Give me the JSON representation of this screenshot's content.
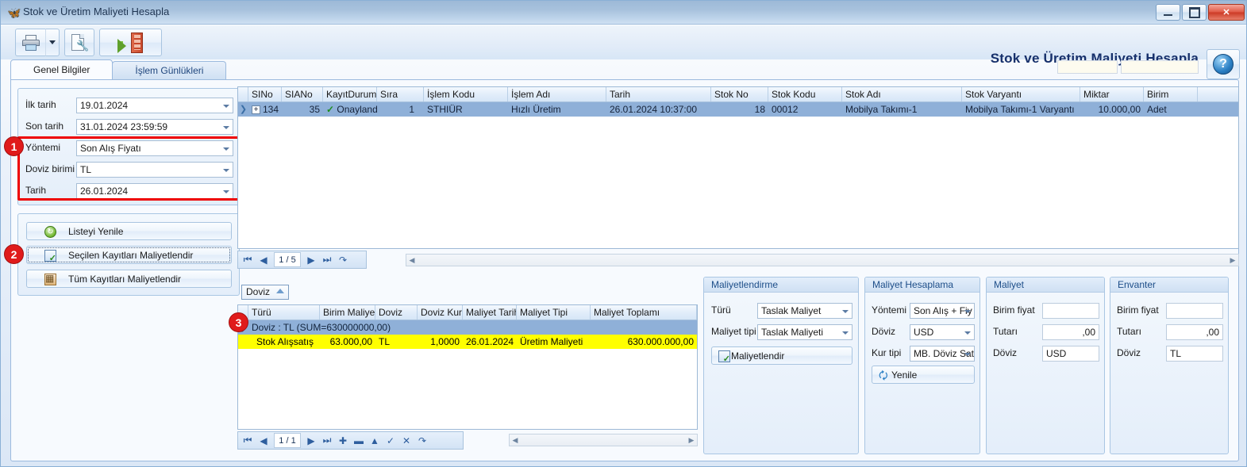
{
  "window": {
    "title": "Stok ve Üretim Maliyeti Hesapla",
    "app_icon": "butterfly-icon",
    "minimize": "–",
    "maximize": "□",
    "close": "✕"
  },
  "toolbar": {
    "print_icon": "printer-icon",
    "print_dropdown_icon": "chevron-down-icon",
    "settings_icon": "document-settings-icon",
    "exit_icon": "exit-door-icon",
    "brand_title": "Stok ve Üretim Maliyeti Hesapla",
    "help_label": "?"
  },
  "tabs": [
    {
      "label": "Genel Bilgiler",
      "active": true
    },
    {
      "label": "İşlem Günlükleri",
      "active": false
    }
  ],
  "filters": {
    "rows": [
      {
        "label": "İlk tarih",
        "value": "19.01.2024"
      },
      {
        "label": "Son tarih",
        "value": "31.01.2024 23:59:59"
      },
      {
        "label": "Yöntemi",
        "value": "Son Alış Fiyatı"
      },
      {
        "label": "Doviz birimi",
        "value": "TL"
      },
      {
        "label": "Tarih",
        "value": "26.01.2024"
      }
    ]
  },
  "actions": {
    "buttons": [
      {
        "label": "Listeyi Yenile",
        "icon": "refresh-icon"
      },
      {
        "label": "Seçilen Kayıtları Maliyetlendir",
        "icon": "selected-records-icon"
      },
      {
        "label": "Tüm Kayıtları Maliyetlendir",
        "icon": "all-records-icon"
      }
    ]
  },
  "callouts": [
    {
      "number": "1"
    },
    {
      "number": "2"
    },
    {
      "number": "3"
    }
  ],
  "top_grid": {
    "columns": [
      "SINo",
      "SIANo",
      "KayıtDurumu",
      "Sıra",
      "İşlem Kodu",
      "İşlem Adı",
      "Tarih",
      "Stok No",
      "Stok Kodu",
      "Stok Adı",
      "Stok Varyantı",
      "Miktar",
      "Birim"
    ],
    "sorted_column": "Sıra",
    "rows": [
      {
        "expander": "+",
        "SINo": "134",
        "SIANo": "35",
        "KayıtDurumu": "Onaylandı",
        "status_icon": "check-icon",
        "Sıra": "1",
        "İşlem Kodu": "STHIÜR",
        "İşlem Adı": "Hızlı Üretim",
        "Tarih": "26.01.2024 10:37:00",
        "Stok No": "18",
        "Stok Kodu": "00012",
        "Stok Adı": "Mobilya Takımı-1",
        "Stok Varyantı": "Mobilya Takımı-1 Varyantı",
        "Miktar": "10.000,00",
        "Birim": "Adet"
      }
    ],
    "nav": {
      "first": "⏮",
      "prev": "◀",
      "position": "1 / 5",
      "next": "▶",
      "last": "⏭",
      "refresh": "↷"
    }
  },
  "bottom_grid": {
    "group_chip": "Doviz",
    "columns": [
      "Türü",
      "Birim Maliyet",
      "Doviz",
      "Doviz Kuru",
      "Maliyet Tarihi",
      "Maliyet Tipi",
      "Maliyet Toplamı"
    ],
    "sorted_column": "Doviz",
    "group_row": "Doviz : TL (SUM=630000000,00)",
    "rows": [
      {
        "Türü": "Stok Alışsatış",
        "Birim Maliyet": "63.000,00",
        "Doviz": "TL",
        "Doviz Kuru": "1,0000",
        "Maliyet Tarihi": "26.01.2024",
        "Maliyet Tipi": "Üretim Maliyeti",
        "Maliyet Toplamı": "630.000.000,00"
      }
    ],
    "nav": {
      "first": "⏮",
      "prev": "◀",
      "position": "1 / 1",
      "next": "▶",
      "last": "⏭",
      "add": "✚",
      "delete": "▬",
      "edit": "▲",
      "post": "✓",
      "cancel": "✕",
      "refresh": "↷"
    }
  },
  "panel_maliyetlendirme": {
    "title": "Maliyetlendirme",
    "fields": [
      {
        "label": "Türü",
        "value": "Taslak Maliyet"
      },
      {
        "label": "Maliyet tipi",
        "value": "Taslak Maliyeti"
      }
    ],
    "button": {
      "label": "Maliyetlendir",
      "icon": "cost-calc-icon"
    }
  },
  "panel_maliyet_hesaplama": {
    "title": "Maliyet Hesaplama",
    "fields": [
      {
        "label": "Yöntemi",
        "value": "Son Alış + Fiy"
      },
      {
        "label": "Döviz",
        "value": "USD"
      },
      {
        "label": "Kur tipi",
        "value": "MB. Döviz Satı"
      }
    ],
    "button": {
      "label": "Yenile",
      "icon": "refresh-blue-icon"
    }
  },
  "panel_maliyet": {
    "title": "Maliyet",
    "fields": [
      {
        "label": "Birim fiyat",
        "value": ""
      },
      {
        "label": "Tutarı",
        "value": ",00"
      },
      {
        "label": "Döviz",
        "value": "USD"
      }
    ]
  },
  "panel_envanter": {
    "title": "Envanter",
    "fields": [
      {
        "label": "Birim fiyat",
        "value": ""
      },
      {
        "label": "Tutarı",
        "value": ",00"
      },
      {
        "label": "Döviz",
        "value": "TL"
      }
    ]
  },
  "colors": {
    "accent": "#16306b",
    "highlight_red": "#ee0000",
    "row_selected": "#8fb0d8",
    "row_yellow": "#ffff00"
  }
}
